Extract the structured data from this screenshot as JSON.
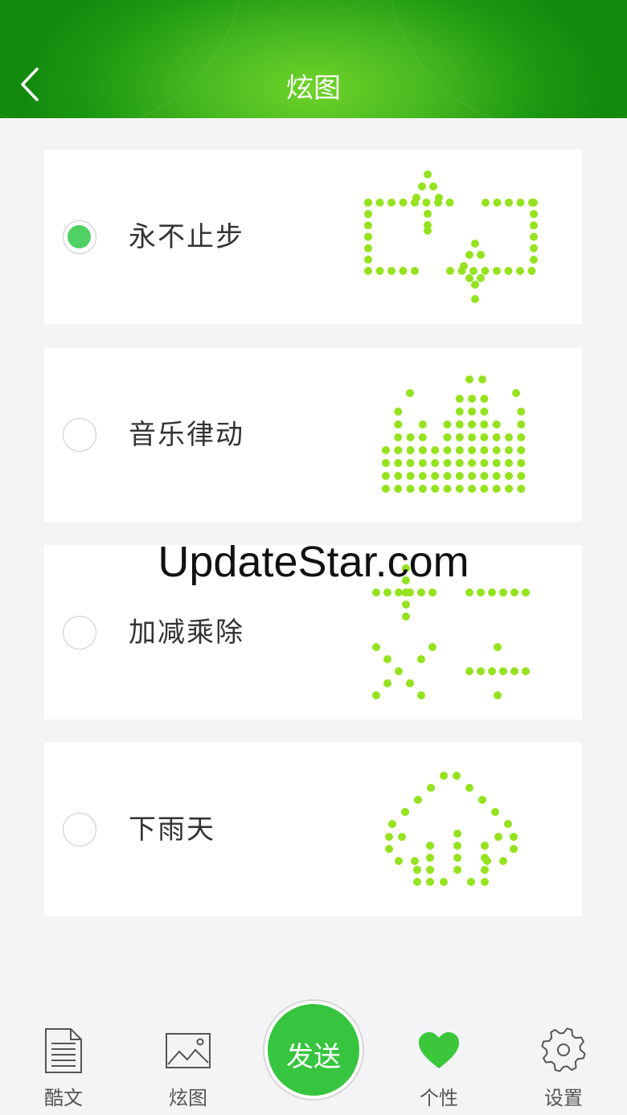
{
  "header": {
    "title": "炫图",
    "back_icon": "chevron-left-icon"
  },
  "options": [
    {
      "label": "永不止步",
      "selected": true,
      "icon": "dot-matrix-loop-arrows"
    },
    {
      "label": "音乐律动",
      "selected": false,
      "icon": "dot-matrix-equalizer"
    },
    {
      "label": "加减乘除",
      "selected": false,
      "icon": "dot-matrix-math-symbols"
    },
    {
      "label": "下雨天",
      "selected": false,
      "icon": "dot-matrix-rain-cloud"
    }
  ],
  "watermark": "UpdateStar.com",
  "tabbar": {
    "tabs": [
      {
        "label": "酷文",
        "icon": "document-icon",
        "active": false
      },
      {
        "label": "炫图",
        "icon": "image-icon",
        "active": false
      },
      {
        "label": "个性",
        "icon": "heart-icon",
        "active": true
      },
      {
        "label": "设置",
        "icon": "gear-icon",
        "active": false
      }
    ],
    "send_label": "发送"
  },
  "colors": {
    "header_green": "#47b820",
    "dot_green": "#95e21f",
    "radio_checked": "#4fd164",
    "send_button": "#37c53f",
    "heart": "#3cc63c"
  }
}
